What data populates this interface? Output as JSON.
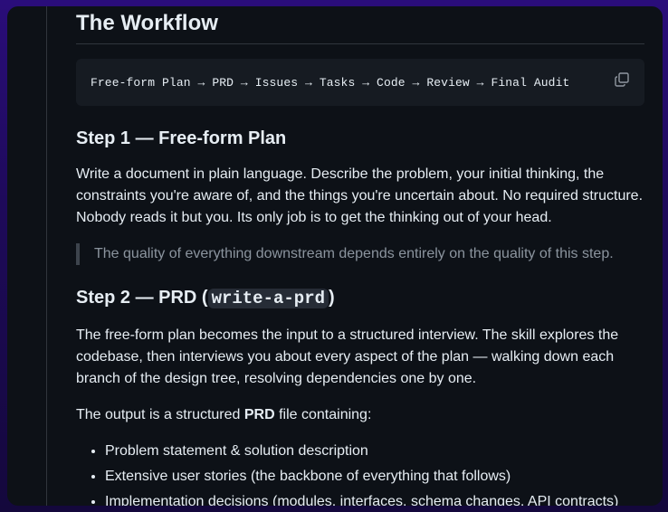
{
  "doc": {
    "title": "The Workflow",
    "pipeline": "Free-form Plan → PRD → Issues → Tasks → Code → Review → Final Audit",
    "step1": {
      "heading": "Step 1 — Free-form Plan",
      "body": "Write a document in plain language. Describe the problem, your initial thinking, the constraints you're aware of, and the things you're uncertain about. No required structure. Nobody reads it but you. Its only job is to get the thinking out of your head.",
      "quote": "The quality of everything downstream depends entirely on the quality of this step."
    },
    "step2": {
      "heading_prefix": "Step 2 — PRD (",
      "heading_code": "write-a-prd",
      "heading_suffix": ")",
      "body": "The free-form plan becomes the input to a structured interview. The skill explores the codebase, then interviews you about every aspect of the plan — walking down each branch of the design tree, resolving dependencies one by one.",
      "output_prefix": "The output is a structured ",
      "output_bold": "PRD",
      "output_suffix": " file containing:",
      "items": [
        "Problem statement & solution description",
        "Extensive user stories (the backbone of everything that follows)",
        "Implementation decisions (modules, interfaces, schema changes, API contracts)"
      ]
    }
  },
  "icons": {
    "copy": "copy-icon"
  },
  "colors": {
    "background_gradient_top": "#2a0d7a",
    "panel": "#0d1117",
    "code_bg": "#161b22",
    "text": "#e6edf3",
    "muted": "#8b949e"
  }
}
